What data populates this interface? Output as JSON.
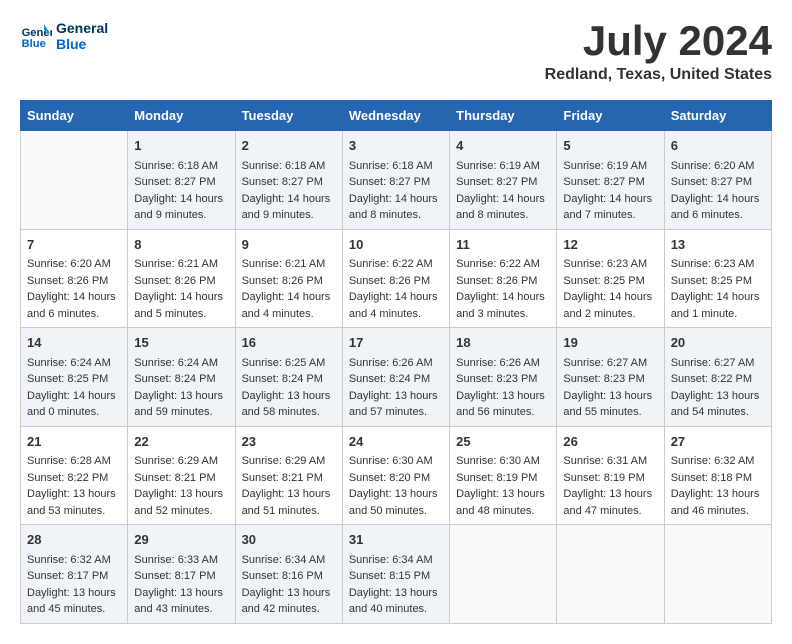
{
  "header": {
    "logo_line1": "General",
    "logo_line2": "Blue",
    "month_title": "July 2024",
    "location": "Redland, Texas, United States"
  },
  "weekdays": [
    "Sunday",
    "Monday",
    "Tuesday",
    "Wednesday",
    "Thursday",
    "Friday",
    "Saturday"
  ],
  "weeks": [
    [
      {
        "day": "",
        "info": ""
      },
      {
        "day": "1",
        "info": "Sunrise: 6:18 AM\nSunset: 8:27 PM\nDaylight: 14 hours\nand 9 minutes."
      },
      {
        "day": "2",
        "info": "Sunrise: 6:18 AM\nSunset: 8:27 PM\nDaylight: 14 hours\nand 9 minutes."
      },
      {
        "day": "3",
        "info": "Sunrise: 6:18 AM\nSunset: 8:27 PM\nDaylight: 14 hours\nand 8 minutes."
      },
      {
        "day": "4",
        "info": "Sunrise: 6:19 AM\nSunset: 8:27 PM\nDaylight: 14 hours\nand 8 minutes."
      },
      {
        "day": "5",
        "info": "Sunrise: 6:19 AM\nSunset: 8:27 PM\nDaylight: 14 hours\nand 7 minutes."
      },
      {
        "day": "6",
        "info": "Sunrise: 6:20 AM\nSunset: 8:27 PM\nDaylight: 14 hours\nand 6 minutes."
      }
    ],
    [
      {
        "day": "7",
        "info": "Sunrise: 6:20 AM\nSunset: 8:26 PM\nDaylight: 14 hours\nand 6 minutes."
      },
      {
        "day": "8",
        "info": "Sunrise: 6:21 AM\nSunset: 8:26 PM\nDaylight: 14 hours\nand 5 minutes."
      },
      {
        "day": "9",
        "info": "Sunrise: 6:21 AM\nSunset: 8:26 PM\nDaylight: 14 hours\nand 4 minutes."
      },
      {
        "day": "10",
        "info": "Sunrise: 6:22 AM\nSunset: 8:26 PM\nDaylight: 14 hours\nand 4 minutes."
      },
      {
        "day": "11",
        "info": "Sunrise: 6:22 AM\nSunset: 8:26 PM\nDaylight: 14 hours\nand 3 minutes."
      },
      {
        "day": "12",
        "info": "Sunrise: 6:23 AM\nSunset: 8:25 PM\nDaylight: 14 hours\nand 2 minutes."
      },
      {
        "day": "13",
        "info": "Sunrise: 6:23 AM\nSunset: 8:25 PM\nDaylight: 14 hours\nand 1 minute."
      }
    ],
    [
      {
        "day": "14",
        "info": "Sunrise: 6:24 AM\nSunset: 8:25 PM\nDaylight: 14 hours\nand 0 minutes."
      },
      {
        "day": "15",
        "info": "Sunrise: 6:24 AM\nSunset: 8:24 PM\nDaylight: 13 hours\nand 59 minutes."
      },
      {
        "day": "16",
        "info": "Sunrise: 6:25 AM\nSunset: 8:24 PM\nDaylight: 13 hours\nand 58 minutes."
      },
      {
        "day": "17",
        "info": "Sunrise: 6:26 AM\nSunset: 8:24 PM\nDaylight: 13 hours\nand 57 minutes."
      },
      {
        "day": "18",
        "info": "Sunrise: 6:26 AM\nSunset: 8:23 PM\nDaylight: 13 hours\nand 56 minutes."
      },
      {
        "day": "19",
        "info": "Sunrise: 6:27 AM\nSunset: 8:23 PM\nDaylight: 13 hours\nand 55 minutes."
      },
      {
        "day": "20",
        "info": "Sunrise: 6:27 AM\nSunset: 8:22 PM\nDaylight: 13 hours\nand 54 minutes."
      }
    ],
    [
      {
        "day": "21",
        "info": "Sunrise: 6:28 AM\nSunset: 8:22 PM\nDaylight: 13 hours\nand 53 minutes."
      },
      {
        "day": "22",
        "info": "Sunrise: 6:29 AM\nSunset: 8:21 PM\nDaylight: 13 hours\nand 52 minutes."
      },
      {
        "day": "23",
        "info": "Sunrise: 6:29 AM\nSunset: 8:21 PM\nDaylight: 13 hours\nand 51 minutes."
      },
      {
        "day": "24",
        "info": "Sunrise: 6:30 AM\nSunset: 8:20 PM\nDaylight: 13 hours\nand 50 minutes."
      },
      {
        "day": "25",
        "info": "Sunrise: 6:30 AM\nSunset: 8:19 PM\nDaylight: 13 hours\nand 48 minutes."
      },
      {
        "day": "26",
        "info": "Sunrise: 6:31 AM\nSunset: 8:19 PM\nDaylight: 13 hours\nand 47 minutes."
      },
      {
        "day": "27",
        "info": "Sunrise: 6:32 AM\nSunset: 8:18 PM\nDaylight: 13 hours\nand 46 minutes."
      }
    ],
    [
      {
        "day": "28",
        "info": "Sunrise: 6:32 AM\nSunset: 8:17 PM\nDaylight: 13 hours\nand 45 minutes."
      },
      {
        "day": "29",
        "info": "Sunrise: 6:33 AM\nSunset: 8:17 PM\nDaylight: 13 hours\nand 43 minutes."
      },
      {
        "day": "30",
        "info": "Sunrise: 6:34 AM\nSunset: 8:16 PM\nDaylight: 13 hours\nand 42 minutes."
      },
      {
        "day": "31",
        "info": "Sunrise: 6:34 AM\nSunset: 8:15 PM\nDaylight: 13 hours\nand 40 minutes."
      },
      {
        "day": "",
        "info": ""
      },
      {
        "day": "",
        "info": ""
      },
      {
        "day": "",
        "info": ""
      }
    ]
  ]
}
